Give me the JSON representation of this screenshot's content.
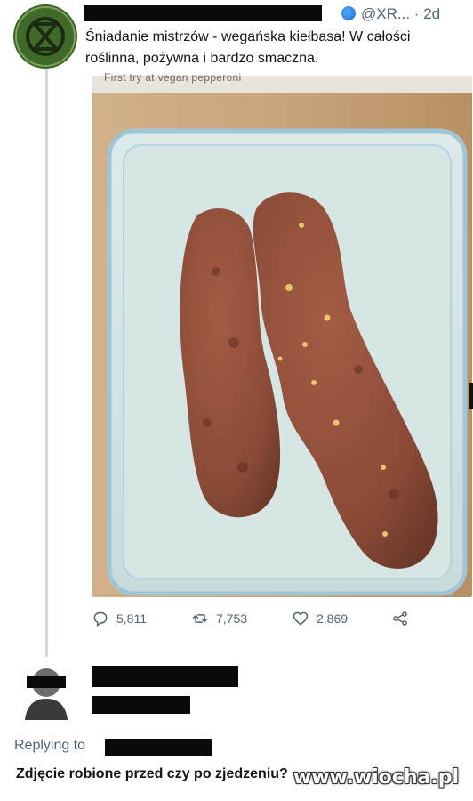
{
  "tweet": {
    "handle": "@XR...",
    "time_separator": "·",
    "time": "2d",
    "text_line1": "Śniadanie mistrzów - wegańska kiełbasa! W całości",
    "text_line2": "roślinna, pożywna i bardzo smaczna.",
    "photo_caption": "First try at vegan pepperoni",
    "stats": {
      "replies": "5,811",
      "retweets": "7,753",
      "likes": "2,869"
    }
  },
  "reply": {
    "replying_to_label": "Replying to",
    "text": "Zdjęcie robione przed czy po zjedzeniu?"
  },
  "watermark": "www.wiocha.pl",
  "icons": {
    "reply": "comment-icon",
    "retweet": "retweet-icon",
    "like": "heart-icon",
    "share": "share-icon",
    "globe": "globe-icon"
  },
  "colors": {
    "text": "#0f1419",
    "secondary": "#536471",
    "thread_line": "#cfd9de",
    "redaction": "#0a0a0a"
  }
}
